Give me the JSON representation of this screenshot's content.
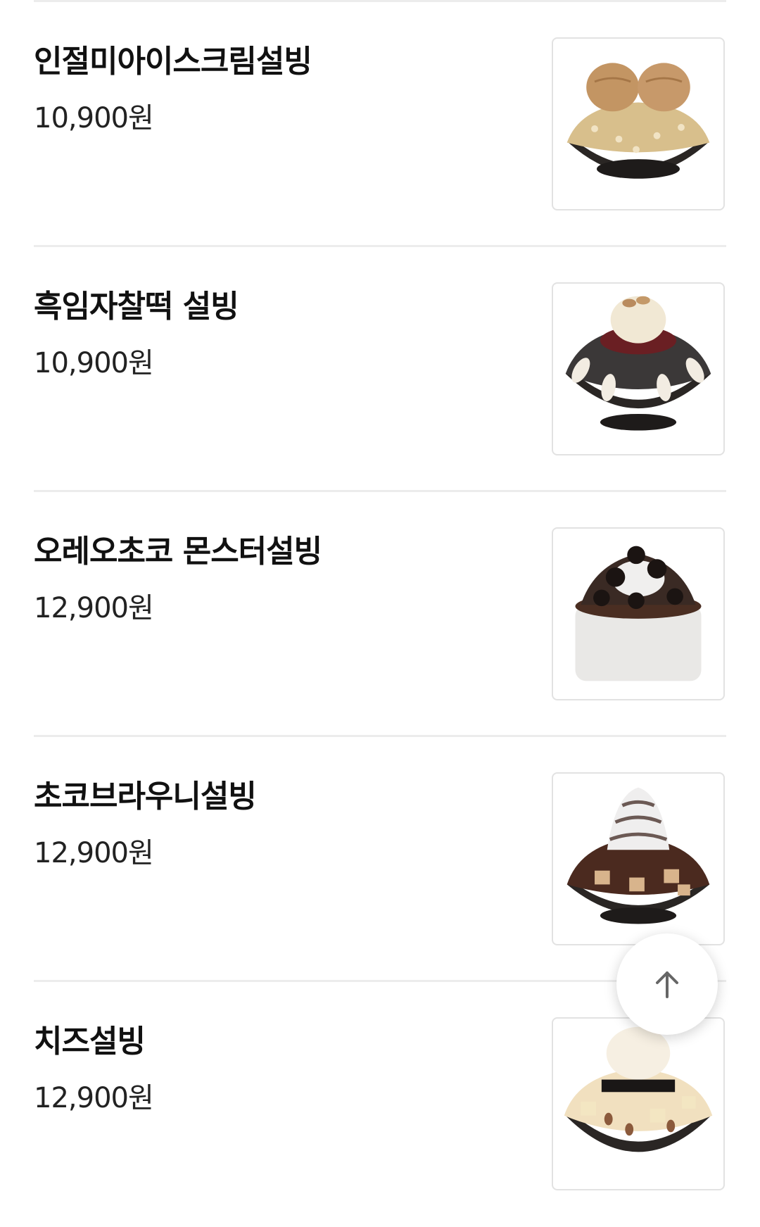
{
  "menu": {
    "items": [
      {
        "name": "인절미아이스크림설빙",
        "price": "10,900원",
        "image": "injeolmi-bingsu-image"
      },
      {
        "name": "흑임자찰떡 설빙",
        "price": "10,900원",
        "image": "black-sesame-bingsu-image"
      },
      {
        "name": "오레오초코 몬스터설빙",
        "price": "12,900원",
        "image": "oreo-choco-bingsu-image"
      },
      {
        "name": "초코브라우니설빙",
        "price": "12,900원",
        "image": "choco-brownie-bingsu-image"
      },
      {
        "name": "치즈설빙",
        "price": "12,900원",
        "image": "cheese-bingsu-image"
      }
    ]
  },
  "scroll_top": {
    "icon": "arrow-up-icon"
  },
  "colors": {
    "divider": "#ececec",
    "text": "#111111",
    "thumb_border": "#e2e2e2"
  }
}
